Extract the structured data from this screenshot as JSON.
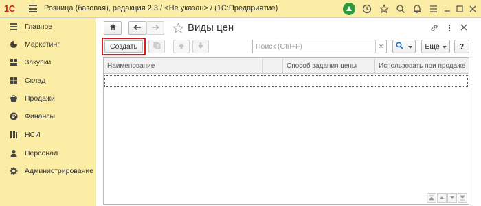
{
  "titlebar": {
    "logo": "1С",
    "title": "Розница (базовая), редакция 2.3 / <Не указан> /  (1С:Предприятие)",
    "icons": [
      "notifications-icon",
      "history-icon",
      "star-icon",
      "search-icon",
      "bell-icon",
      "menu-icon",
      "minimize-icon",
      "maximize-icon",
      "close-icon"
    ]
  },
  "sidebar": {
    "items": [
      {
        "label": "Главное",
        "icon": "menu-lines-icon"
      },
      {
        "label": "Маркетинг",
        "icon": "pie-chart-icon"
      },
      {
        "label": "Закупки",
        "icon": "purchases-icon"
      },
      {
        "label": "Склад",
        "icon": "warehouse-icon"
      },
      {
        "label": "Продажи",
        "icon": "basket-icon"
      },
      {
        "label": "Финансы",
        "icon": "ruble-icon"
      },
      {
        "label": "НСИ",
        "icon": "books-icon"
      },
      {
        "label": "Персонал",
        "icon": "person-icon"
      },
      {
        "label": "Администрирование",
        "icon": "gear-icon"
      }
    ]
  },
  "main": {
    "title": "Виды цен",
    "create_label": "Создать",
    "search_placeholder": "Поиск (Ctrl+F)",
    "clear_symbol": "×",
    "more_label": "Еще",
    "help_label": "?",
    "table": {
      "columns": [
        "Наименование",
        "",
        "Способ задания цены",
        "Использовать при продаже"
      ]
    }
  },
  "colors": {
    "panel": "#fbeda5",
    "create_highlight": "#d21c1c",
    "notif_green": "#2e9a3b"
  }
}
